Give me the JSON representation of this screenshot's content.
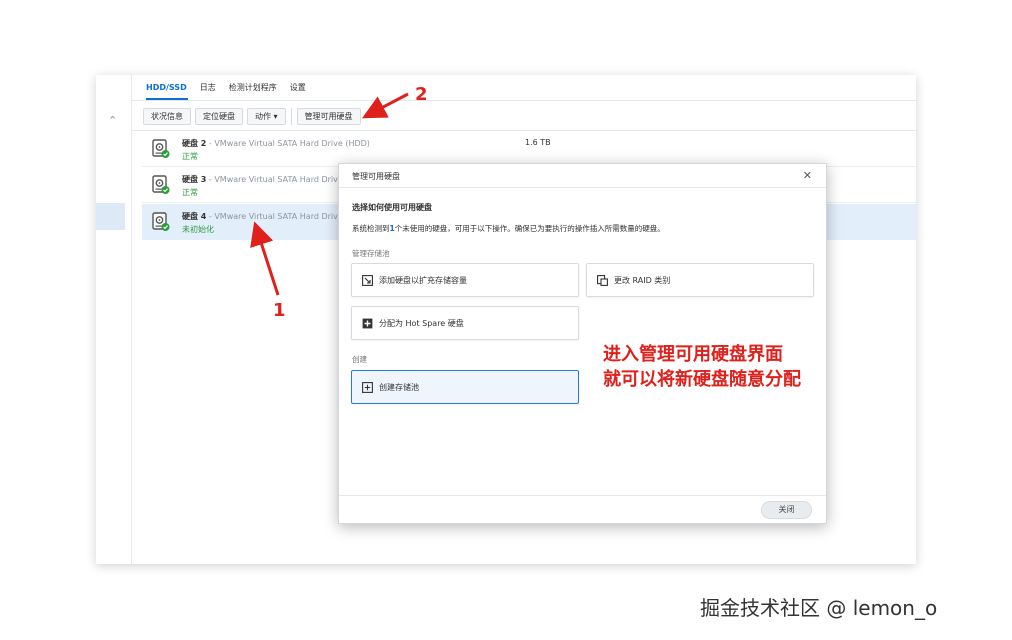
{
  "tabs": [
    {
      "label": "HDD/SSD",
      "active": true
    },
    {
      "label": "日志",
      "active": false
    },
    {
      "label": "检测计划程序",
      "active": false
    },
    {
      "label": "设置",
      "active": false
    }
  ],
  "toolbar": {
    "status_info": "状况信息",
    "locate_disk": "定位硬盘",
    "action": "动作",
    "manage_available": "管理可用硬盘"
  },
  "disks": [
    {
      "name": "硬盘 2",
      "model": "- VMware Virtual SATA Hard Drive (HDD)",
      "size": "1.6 TB",
      "status": "正常"
    },
    {
      "name": "硬盘 3",
      "model": "- VMware Virtual SATA Hard Drive",
      "size": "",
      "status": "正常"
    },
    {
      "name": "硬盘 4",
      "model": "- VMware Virtual SATA Hard Drive",
      "size": "",
      "status": "未初始化"
    }
  ],
  "dialog": {
    "title": "管理可用硬盘",
    "heading": "选择如何使用可用硬盘",
    "desc_prefix": "系统检测到",
    "desc_count": "1",
    "desc_suffix": "个未使用的硬盘，可用于以下操作。确保已为要执行的操作插入所需数量的硬盘。",
    "section_manage": "管理存储池",
    "opt_add": "添加硬盘以扩充存储容量",
    "opt_raid": "更改 RAID 类别",
    "opt_hotspare": "分配为 Hot Spare 硬盘",
    "section_create": "创建",
    "opt_create": "创建存储池",
    "close_button": "关闭"
  },
  "annotations": {
    "label_1": "1",
    "label_2": "2",
    "note_line1": "进入管理可用硬盘界面",
    "note_line2": "就可以将新硬盘随意分配"
  },
  "watermark": "掘金技术社区 @ lemon_o",
  "colors": {
    "accent": "#0c6fd1",
    "status_ok": "#2a9d3a",
    "annotation_red": "#e0201b"
  }
}
